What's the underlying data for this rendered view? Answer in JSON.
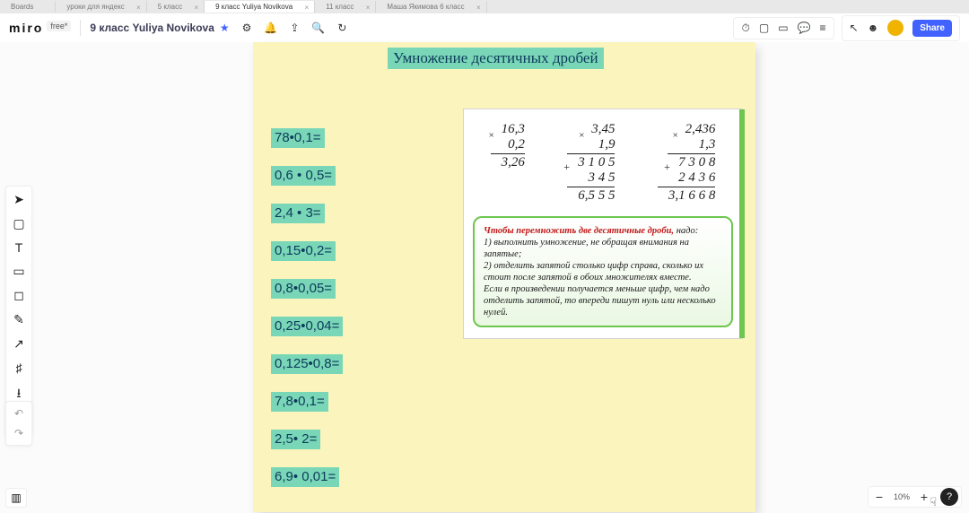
{
  "tabs": {
    "t0": "Boards",
    "t1": "уроки для яндекс",
    "t2": "5 класс",
    "t3": "9 класс Yuliya Novikova",
    "t4": "11 класс",
    "t5": "Маша Якимова 6 класс"
  },
  "header": {
    "logo": "miro",
    "plan": "free*",
    "board": "9 класс Yuliya Novikova",
    "share": "Share"
  },
  "zoom": {
    "minus": "−",
    "pct": "10%",
    "plus": "+",
    "help": "?"
  },
  "note": {
    "title": "Умножение десятичных дробей",
    "eqs": {
      "e0": "78•0,1=",
      "e1": "0,6 • 0,5=",
      "e2": "2,4 • 3=",
      "e3": "0,15•0,2=",
      "e4": "0,8•0,05=",
      "e5": "0,25•0,04=",
      "e6": "0,125•0,8=",
      "e7": "7,8•0,1=",
      "e8": "2,5• 2=",
      "e9": "6,9• 0,01="
    }
  },
  "panel": {
    "c1": {
      "a": "16,3",
      "b": "0,2",
      "r": "3,26"
    },
    "c2": {
      "a": "3,45",
      "b": "1,9",
      "p1": "3 1 0 5",
      "p2": "3 4 5",
      "r": "6,5 5 5"
    },
    "c3": {
      "a": "2,436",
      "b": "1,3",
      "p1": "7 3 0 8",
      "p2": "2 4 3 6",
      "r": "3,1 6 6 8"
    },
    "rule": {
      "lead": "Чтобы перемножить две десятичные дроби,",
      "tail0": " надо:",
      "l1": "1) выполнить умножение, не обращая внимания на запятые;",
      "l2": "2) отделить запятой столько цифр справа, сколько их стоит после запятой в обоих множителях вместе.",
      "l3": "Если в произведении получается меньше цифр, чем надо отделить запятой, то впереди пишут нуль или несколько нулей."
    }
  }
}
